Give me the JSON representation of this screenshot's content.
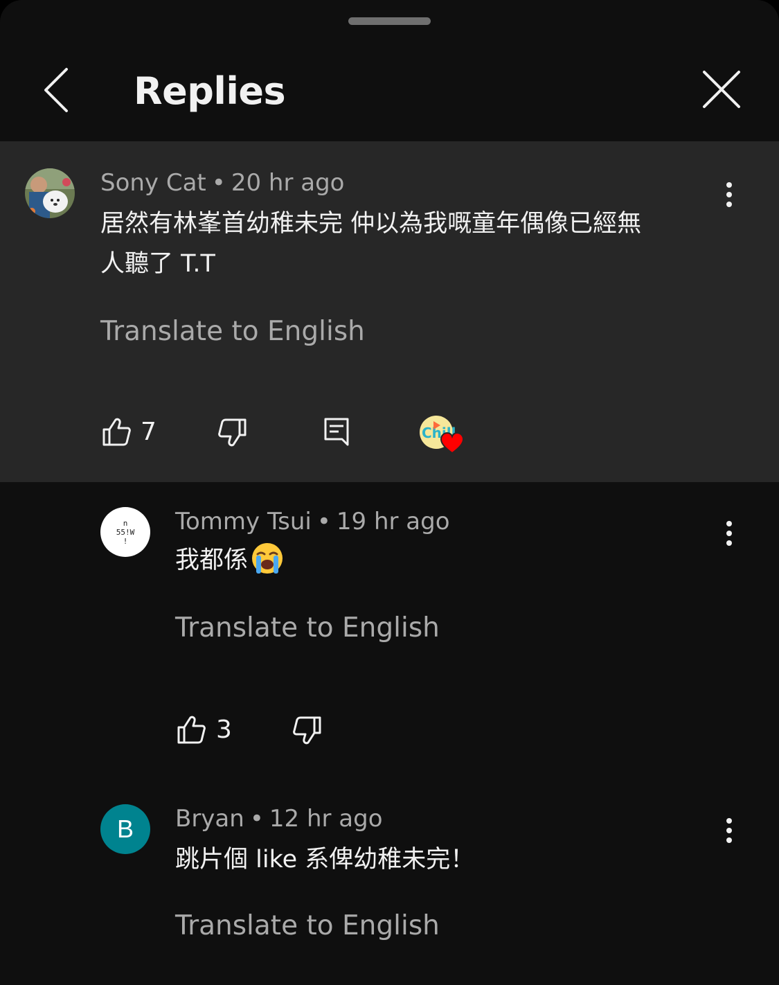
{
  "header": {
    "title": "Replies"
  },
  "parent": {
    "author": "Sony Cat",
    "time": "20 hr ago",
    "text_line1": "居然有林峯首幼稚未完 仲以為我嘅童年偶像已經無",
    "text_line2": "人聽了 T.T",
    "translate": "Translate to English",
    "likes": "7",
    "creator_heart": "heart-icon"
  },
  "replies": [
    {
      "author": "Tommy Tsui",
      "time": "19 hr ago",
      "text": "我都係",
      "emoji": "loudly-crying-face",
      "avatar_text_1": "n",
      "avatar_text_2": "55!W",
      "avatar_text_3": "!",
      "translate": "Translate to English",
      "likes": "3"
    },
    {
      "author": "Bryan",
      "time": "12 hr ago",
      "text": "跳片個 like 系俾幼稚未完！",
      "avatar_letter": "B",
      "avatar_color": "#00838f",
      "translate": "Translate to English"
    }
  ],
  "separator": "•",
  "colors": {
    "background": "#0f0f0f",
    "highlight": "#272727",
    "text": "#f1f1f1",
    "secondary": "#aaaaaa",
    "heart": "#ff0000"
  }
}
